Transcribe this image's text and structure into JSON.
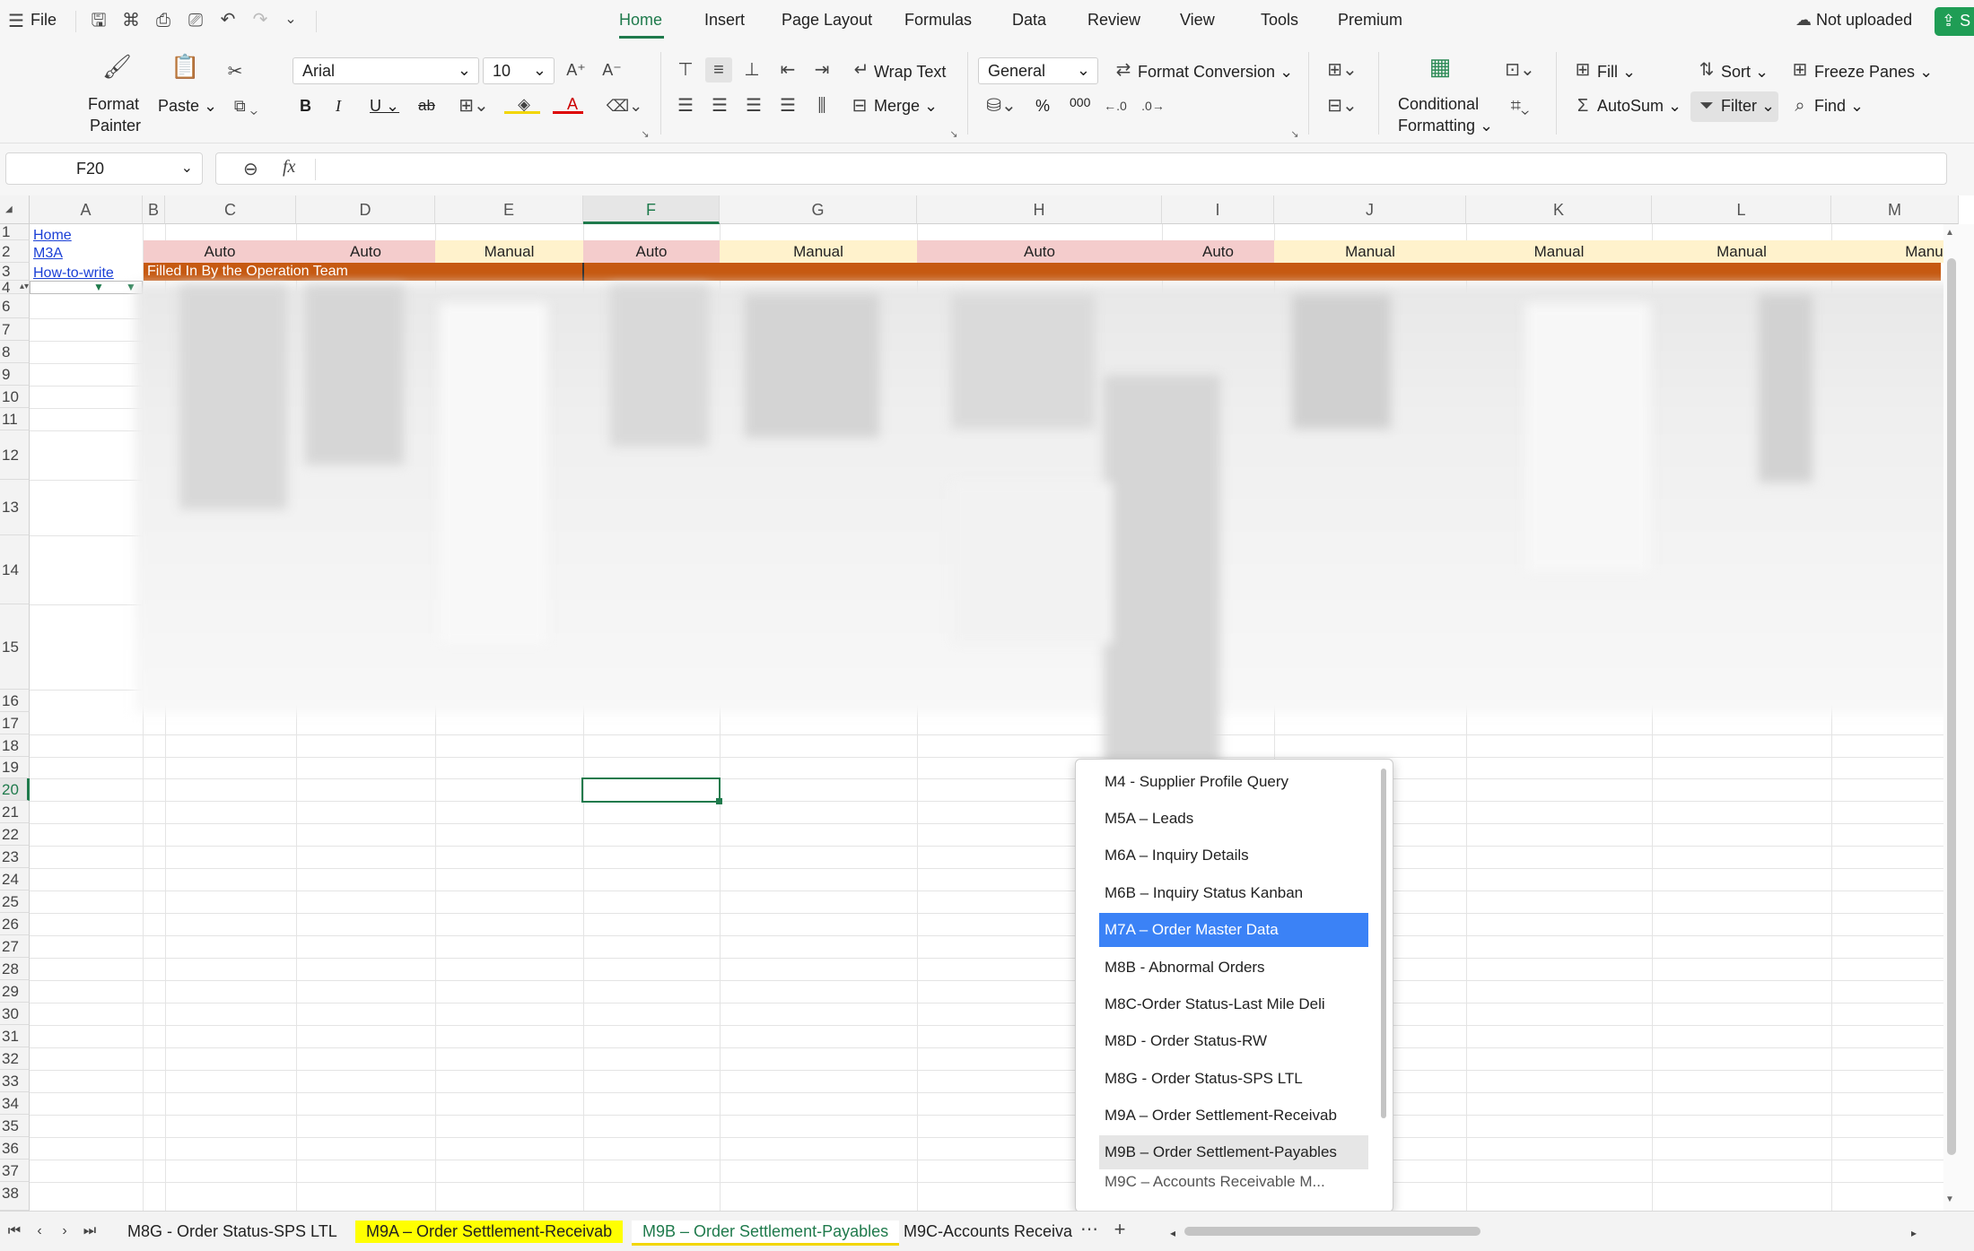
{
  "menu": {
    "file": "File",
    "tabs": [
      "Home",
      "Insert",
      "Page Layout",
      "Formulas",
      "Data",
      "Review",
      "View",
      "Tools",
      "Premium"
    ],
    "active_tab": "Home",
    "not_uploaded": "Not uploaded",
    "share": "S"
  },
  "ribbon": {
    "format_painter_1": "Format",
    "format_painter_2": "Painter",
    "paste": "Paste",
    "font": "Arial",
    "size": "10",
    "wrap_text": "Wrap Text",
    "merge": "Merge",
    "number_format": "General",
    "format_conversion": "Format Conversion",
    "cond_1": "Conditional",
    "cond_2": "Formatting",
    "fill": "Fill",
    "autosum": "AutoSum",
    "sort": "Sort",
    "filter": "Filter",
    "freeze": "Freeze Panes",
    "find": "Find",
    "bold": "B",
    "italic": "I",
    "underline": "U",
    "strike": "ab",
    "percent": "%",
    "thousands": "000"
  },
  "formula_bar": {
    "name_box": "F20",
    "fx": "fx",
    "value": ""
  },
  "columns": [
    "A",
    "B",
    "C",
    "D",
    "E",
    "F",
    "G",
    "H",
    "I",
    "J",
    "K",
    "L",
    "M"
  ],
  "rows": [
    "1",
    "2",
    "3",
    "4",
    "6",
    "7",
    "8",
    "9",
    "10",
    "11",
    "12",
    "13",
    "14",
    "15",
    "16",
    "17",
    "18",
    "19",
    "20",
    "21",
    "22",
    "23",
    "24",
    "25",
    "26",
    "27",
    "28",
    "29",
    "30",
    "31",
    "32",
    "33",
    "34",
    "35",
    "36",
    "37",
    "38"
  ],
  "cells": {
    "a1": "Home",
    "a2": "M3A",
    "a3": "How-to-write",
    "row2": [
      "Auto",
      "Auto",
      "Manual",
      "Auto",
      "Manual",
      "Auto",
      "Auto",
      "Manual",
      "Manual",
      "Manual",
      "Manual"
    ],
    "row3": "Filled In By the Operation Team"
  },
  "colors": {
    "auto_fill": "#f4cccc",
    "manual_fill": "#fff2cc",
    "header_band": "#c65911",
    "accent": "#1f7a4c",
    "selected_item": "#3b82f6"
  },
  "sheet_tabs": [
    "M8G - Order Status-SPS LTL",
    "M9A – Order Settlement-Receivab",
    "M9B – Order Settlement-Payables",
    "M9C-Accounts Receiva"
  ],
  "popup_items": [
    "M4 - Supplier Profile Query",
    "M5A – Leads",
    "M6A – Inquiry Details",
    "M6B – Inquiry Status Kanban",
    "M7A – Order Master Data",
    "M8B - Abnormal Orders",
    "M8C-Order Status-Last Mile Deli",
    "M8D - Order Status-RW",
    "M8G - Order Status-SPS LTL",
    "M9A – Order Settlement-Receivab",
    "M9B – Order Settlement-Payables",
    "M9C – Accounts Receivable M..."
  ]
}
